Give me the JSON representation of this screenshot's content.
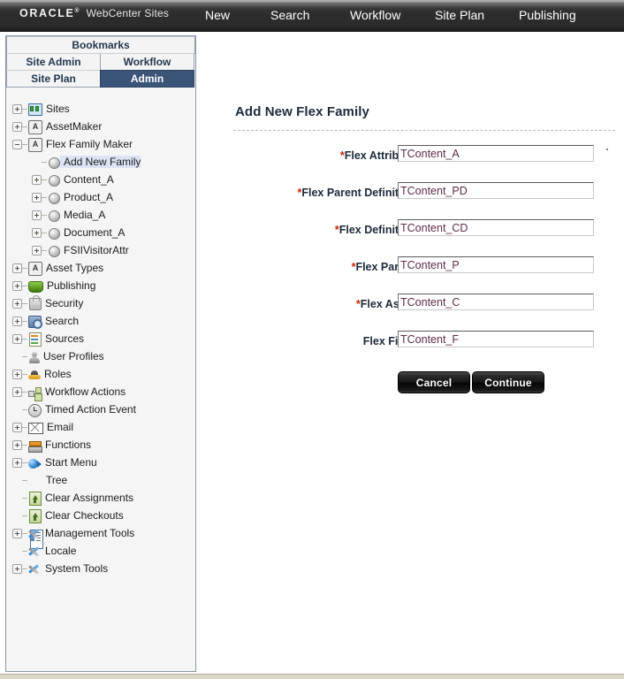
{
  "header": {
    "logo": "ORACLE",
    "logo_tm": "®",
    "product": "WebCenter Sites",
    "nav": [
      {
        "label": "New",
        "name": "nav-new"
      },
      {
        "label": "Search",
        "name": "nav-search"
      },
      {
        "label": "Workflow",
        "name": "nav-workflow"
      },
      {
        "label": "Site Plan",
        "name": "nav-site-plan"
      },
      {
        "label": "Publishing",
        "name": "nav-publishing"
      }
    ]
  },
  "sidebar": {
    "bookmarks_label": "Bookmarks",
    "tabs": [
      {
        "label": "Site Admin",
        "active": false
      },
      {
        "label": "Workflow",
        "active": false
      },
      {
        "label": "Site Plan",
        "active": false
      },
      {
        "label": "Admin",
        "active": true
      }
    ],
    "active_tab_color": "#3a5578",
    "selected_node_color": "#dce3f4",
    "tree": [
      {
        "label": "Sites",
        "icon": "sites",
        "expander": "plus",
        "indent": 0,
        "selected": false
      },
      {
        "label": "AssetMaker",
        "icon": "amaker",
        "expander": "plus",
        "indent": 0,
        "selected": false
      },
      {
        "label": "Flex Family Maker",
        "icon": "amaker",
        "expander": "minus",
        "indent": 0,
        "selected": false
      },
      {
        "label": "Add New Family",
        "icon": "ball",
        "expander": "none",
        "indent": 1,
        "selected": true
      },
      {
        "label": "Content_A",
        "icon": "ball",
        "expander": "plus",
        "indent": 1,
        "selected": false
      },
      {
        "label": "Product_A",
        "icon": "ball",
        "expander": "plus",
        "indent": 1,
        "selected": false
      },
      {
        "label": "Media_A",
        "icon": "ball",
        "expander": "plus",
        "indent": 1,
        "selected": false
      },
      {
        "label": "Document_A",
        "icon": "ball",
        "expander": "plus",
        "indent": 1,
        "selected": false
      },
      {
        "label": "FSIIVisitorAttr",
        "icon": "ball",
        "expander": "plus",
        "indent": 1,
        "selected": false
      },
      {
        "label": "Asset Types",
        "icon": "amaker",
        "expander": "plus",
        "indent": 0,
        "selected": false
      },
      {
        "label": "Publishing",
        "icon": "pub",
        "expander": "plus",
        "indent": 0,
        "selected": false
      },
      {
        "label": "Security",
        "icon": "sec",
        "expander": "plus",
        "indent": 0,
        "selected": false
      },
      {
        "label": "Search",
        "icon": "search",
        "expander": "plus",
        "indent": 0,
        "selected": false
      },
      {
        "label": "Sources",
        "icon": "src",
        "expander": "plus",
        "indent": 0,
        "selected": false
      },
      {
        "label": "User Profiles",
        "icon": "user",
        "expander": "none",
        "indent": 0,
        "selected": false
      },
      {
        "label": "Roles",
        "icon": "roles",
        "expander": "plus",
        "indent": 0,
        "selected": false
      },
      {
        "label": "Workflow Actions",
        "icon": "wfa",
        "expander": "plus",
        "indent": 0,
        "selected": false
      },
      {
        "label": "Timed Action Event",
        "icon": "clock",
        "expander": "none",
        "indent": 0,
        "selected": false
      },
      {
        "label": "Email",
        "icon": "mail",
        "expander": "plus",
        "indent": 0,
        "selected": false
      },
      {
        "label": "Functions",
        "icon": "func",
        "expander": "plus",
        "indent": 0,
        "selected": false
      },
      {
        "label": "Start Menu",
        "icon": "smenu",
        "expander": "plus",
        "indent": 0,
        "selected": false
      },
      {
        "label": "Tree",
        "icon": "tree",
        "expander": "none",
        "indent": 0,
        "selected": false
      },
      {
        "label": "Clear Assignments",
        "icon": "clear",
        "expander": "none",
        "indent": 0,
        "selected": false
      },
      {
        "label": "Clear Checkouts",
        "icon": "clear",
        "expander": "none",
        "indent": 0,
        "selected": false
      },
      {
        "label": "Management Tools",
        "icon": "tools",
        "expander": "plus",
        "indent": 0,
        "selected": false
      },
      {
        "label": "Locale",
        "icon": "tools",
        "expander": "none",
        "indent": 0,
        "selected": false
      },
      {
        "label": "System Tools",
        "icon": "tools",
        "expander": "plus",
        "indent": 0,
        "selected": false
      }
    ]
  },
  "main": {
    "title": "Add New Flex Family",
    "fields": [
      {
        "label": "Flex Attribute:",
        "required": true,
        "value": "TContent_A",
        "name": "flex-attribute"
      },
      {
        "label": "Flex Parent Definition:",
        "required": true,
        "value": "TContent_PD",
        "name": "flex-parent-definition"
      },
      {
        "label": "Flex Definition:",
        "required": true,
        "value": "TContent_CD",
        "name": "flex-definition"
      },
      {
        "label": "Flex Parent:",
        "required": true,
        "value": "TContent_P",
        "name": "flex-parent"
      },
      {
        "label": "Flex Asset:",
        "required": true,
        "value": "TContent_C",
        "name": "flex-asset"
      },
      {
        "label": "Flex Filter:",
        "required": false,
        "value": "TContent_F",
        "name": "flex-filter"
      }
    ],
    "buttons": {
      "cancel": "Cancel",
      "continue": "Continue"
    },
    "required_marker": "*",
    "required_marker_color": "#cc2200",
    "input_text_color": "#5c2b4a"
  }
}
